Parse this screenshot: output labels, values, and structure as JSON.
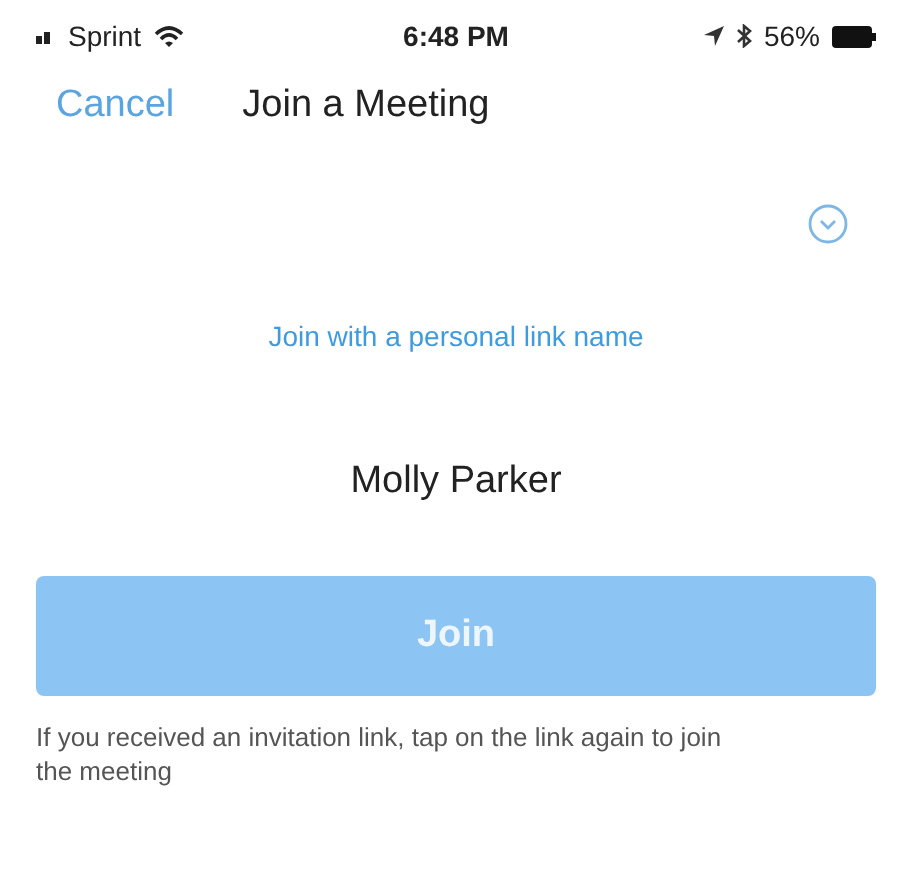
{
  "status_bar": {
    "carrier": "Sprint",
    "time": "6:48 PM",
    "battery": "56%"
  },
  "nav": {
    "cancel": "Cancel",
    "title": "Join a Meeting"
  },
  "link_option": "Join with a personal link name",
  "name_field": {
    "value": "Molly Parker"
  },
  "join_button": {
    "label": "Join",
    "disabled": true
  },
  "note": "If you received an invitation link, tap on the link again to join the meeting"
}
